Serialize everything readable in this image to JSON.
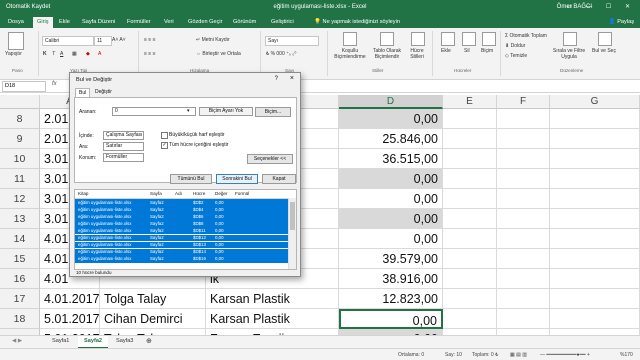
{
  "window": {
    "title": "eğitim uygulaması-liste.xlsx  -  Excel",
    "autosave": "Otomatik Kaydet",
    "user": "Ömer BAĞCI",
    "share": "Paylaş"
  },
  "ribbon_tabs": [
    "Dosya",
    "Giriş",
    "Ekle",
    "Sayfa Düzeni",
    "Formüller",
    "Veri",
    "Gözden Geçir",
    "Görünüm",
    "Geliştirici",
    "Ne yapmak istediğinizi söyleyin"
  ],
  "ribbon": {
    "paste": "Yapıştır",
    "font": "Calibri",
    "font_size": "11",
    "wrap_text": "Metni Kaydır",
    "merge": "Birleştir ve Ortala",
    "number_format": "Sayı",
    "conditional": "Koşullu Biçimlendirme",
    "table": "Tablo Olarak Biçimlendir",
    "cell_styles": "Hücre Stilleri",
    "insert": "Ekle",
    "delete": "Sil",
    "format": "Biçim",
    "autosum": "Otomatik Toplam",
    "fill": "Doldur",
    "clear": "Temizle",
    "sort": "Sırala ve Filtre Uygula",
    "find": "Bul ve Seç",
    "groups": [
      "Pano",
      "Yazı Tipi",
      "Hizalama",
      "Sayı",
      "Stiller",
      "Hücreler",
      "Düzenleme"
    ]
  },
  "formula_bar": {
    "name_box": "D18",
    "fx": "fx",
    "value": ""
  },
  "columns": [
    "A",
    "B",
    "C",
    "D",
    "E",
    "F",
    "G"
  ],
  "rows": [
    {
      "n": "8",
      "a": "2.01",
      "b": "",
      "c": "",
      "d": "0,00",
      "dg": true
    },
    {
      "n": "9",
      "a": "2.01",
      "b": "",
      "c": "ki",
      "d": "25.846,00",
      "dg": false
    },
    {
      "n": "10",
      "a": "3.01",
      "b": "",
      "c": "ki",
      "d": "36.515,00",
      "dg": false
    },
    {
      "n": "11",
      "a": "3.01",
      "b": "",
      "c": "ik",
      "d": "0,00",
      "dg": true
    },
    {
      "n": "12",
      "a": "3.01",
      "b": "",
      "c": "ik",
      "d": "0,00",
      "dg": false
    },
    {
      "n": "13",
      "a": "3.01",
      "b": "",
      "c": "ik",
      "d": "0,00",
      "dg": true
    },
    {
      "n": "14",
      "a": "4.01",
      "b": "",
      "c": "liyat",
      "d": "0,00",
      "dg": false
    },
    {
      "n": "15",
      "a": "4.01",
      "b": "",
      "c": "",
      "d": "39.579,00",
      "dg": false
    },
    {
      "n": "16",
      "a": "4.01",
      "b": "",
      "c": "ik",
      "d": "38.916,00",
      "dg": false
    },
    {
      "n": "17",
      "a": "4.01.2017",
      "b": "Tolga Talay",
      "c": "Karsan Plastik",
      "d": "12.823,00",
      "dg": false
    },
    {
      "n": "18",
      "a": "5.01.2017",
      "b": "Cihan Demirci",
      "c": "Karsan Plastik",
      "d": "0,00",
      "dg": false
    },
    {
      "n": "19",
      "a": "5.01.2017",
      "b": "Tolga Talay",
      "c": "Fernas Enerji",
      "d": "0,00",
      "dg": true
    },
    {
      "n": "20",
      "a": "5.01.2017",
      "b": "Tolga Talay",
      "c": "Karsan Plastik",
      "d": "37.678,00",
      "dg": false
    }
  ],
  "sheets": [
    "Sayfa1",
    "Sayfa2",
    "Sayfa3"
  ],
  "status": {
    "average": "Ortalama: 0",
    "count": "Say: 10",
    "sum": "Toplam: 0 ₺",
    "zoom": "%170"
  },
  "dialog": {
    "title": "Bul ve Değiştir",
    "help": "?",
    "close": "×",
    "tab_find": "Bul",
    "tab_replace": "Değiştir",
    "find_label": "Aranan:",
    "find_value": "0",
    "format_preview": "Biçim Ayarı Yok",
    "format_button": "Biçim...",
    "within_label": "İçinde:",
    "within_value": "Çalışma Sayfası",
    "search_label": "Ara:",
    "search_value": "Satırlar",
    "lookin_label": "Konum:",
    "lookin_value": "Formüller",
    "match_case": "Büyük/küçük harf eşleştir",
    "match_entire": "Tüm hücre içeriğini eşleştir",
    "options_button": "Seçenekler <<",
    "find_all": "Tümünü Bul",
    "find_next": "Sonrakini Bul",
    "close_button": "Kapat",
    "results_headers": [
      "Kitap",
      "Sayfa",
      "Adı",
      "Hücre",
      "Değer",
      "Formül"
    ],
    "results": [
      {
        "book": "eğitim uygulaması-liste.xlsx",
        "sheet": "Sayfa2",
        "name": "",
        "cell": "$D$2",
        "value": "0,00"
      },
      {
        "book": "eğitim uygulaması-liste.xlsx",
        "sheet": "Sayfa2",
        "name": "",
        "cell": "$D$4",
        "value": "0,00"
      },
      {
        "book": "eğitim uygulaması-liste.xlsx",
        "sheet": "Sayfa2",
        "name": "",
        "cell": "$D$6",
        "value": "0,00"
      },
      {
        "book": "eğitim uygulaması-liste.xlsx",
        "sheet": "Sayfa2",
        "name": "",
        "cell": "$D$8",
        "value": "0,00"
      },
      {
        "book": "eğitim uygulaması-liste.xlsx",
        "sheet": "Sayfa2",
        "name": "",
        "cell": "$D$11",
        "value": "0,00"
      },
      {
        "book": "eğitim uygulaması-liste.xlsx",
        "sheet": "Sayfa2",
        "name": "",
        "cell": "$D$12",
        "value": "0,00"
      },
      {
        "book": "eğitim uygulaması-liste.xlsx",
        "sheet": "Sayfa2",
        "name": "",
        "cell": "$D$13",
        "value": "0,00"
      },
      {
        "book": "eğitim uygulaması-liste.xlsx",
        "sheet": "Sayfa2",
        "name": "",
        "cell": "$D$14",
        "value": "0,00"
      },
      {
        "book": "eğitim uygulaması-liste.xlsx",
        "sheet": "Sayfa2",
        "name": "",
        "cell": "$D$16",
        "value": "0,00"
      }
    ],
    "found_count": "10 hücre bulundu"
  },
  "colors": {
    "brand": "#217346",
    "selection": "#0078d7",
    "cell_gray": "#d9d9d9"
  }
}
